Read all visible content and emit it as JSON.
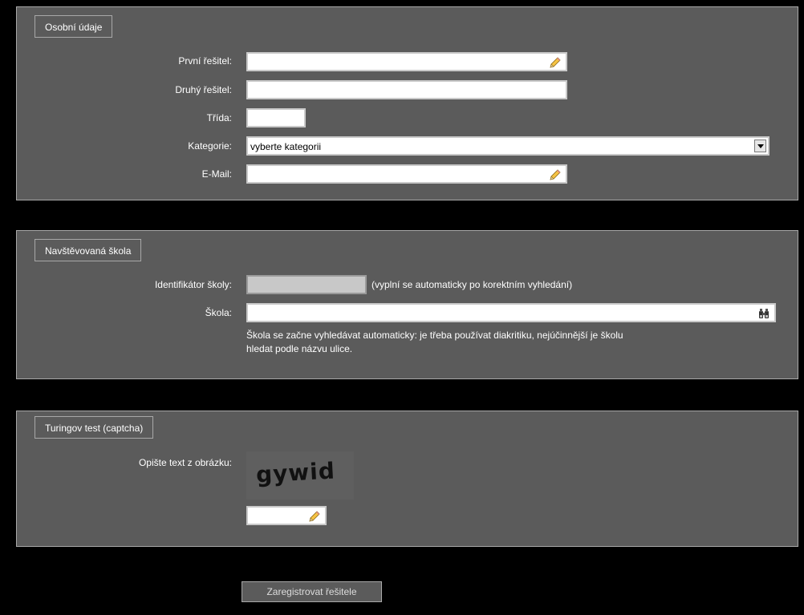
{
  "personal": {
    "legend": "Osobní údaje",
    "first_solver_label": "První řešitel:",
    "first_solver_value": "",
    "second_solver_label": "Druhý řešitel:",
    "second_solver_value": "",
    "class_label": "Třída:",
    "class_value": "",
    "category_label": "Kategorie:",
    "category_value": "vyberte kategorii",
    "email_label": "E-Mail:",
    "email_value": ""
  },
  "school": {
    "legend": "Navštěvovaná škola",
    "id_label": "Identifikátor školy:",
    "id_value": "",
    "id_hint": "(vyplní se automaticky po korektním vyhledání)",
    "school_label": "Škola:",
    "school_value": "",
    "school_hint_line1": "Škola se začne vyhledávat automaticky: je třeba používat diakritiku, nejúčinnější je školu",
    "school_hint_line2": "hledat podle názvu ulice."
  },
  "captcha": {
    "legend": "Turingov test (captcha)",
    "label": "Opište text z obrázku:",
    "image_text": "gywid",
    "value": ""
  },
  "submit_label": "Zaregistrovat řešitele",
  "icons": {
    "edit": "pencil-icon",
    "lookup": "binoculars-icon",
    "dropdown": "chevron-down-icon"
  }
}
